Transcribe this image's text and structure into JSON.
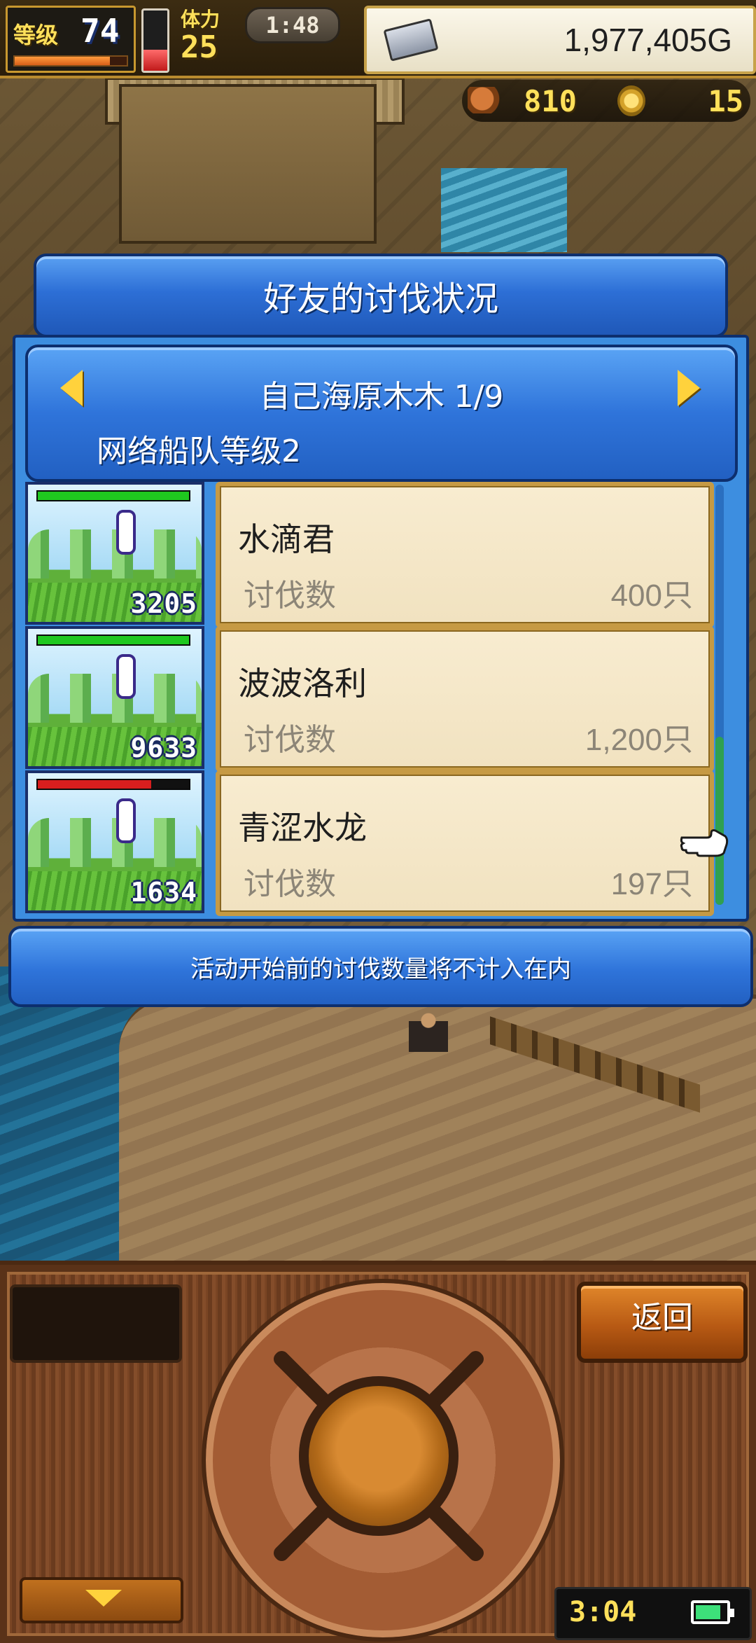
{
  "hud": {
    "level_label": "等级",
    "level_value": "74",
    "level_progress": 0.85,
    "stamina_level": 0.35,
    "strength_label": "体力",
    "strength_value": "25",
    "clock": "1:48",
    "gold": "1,977,405G",
    "food": "810",
    "coins": "15"
  },
  "dialog": {
    "title": "好友的讨伐状况",
    "friend_name": "自己海原木木 1/9",
    "fleet_level": "网络船队等级2",
    "notice": "活动开始前的讨伐数量将不计入在内",
    "kill_label": "讨伐数",
    "entries": [
      {
        "monster_id": "3205",
        "name": "水滴君",
        "kills": "400只",
        "hp_fraction": 1.0,
        "hp_color": "#1fc81f"
      },
      {
        "monster_id": "9633",
        "name": "波波洛利",
        "kills": "1,200只",
        "hp_fraction": 1.0,
        "hp_color": "#1fc81f"
      },
      {
        "monster_id": "1634",
        "name": "青涩水龙",
        "kills": "197只",
        "hp_fraction": 0.75,
        "hp_color": "#d81e1e"
      }
    ]
  },
  "controller": {
    "back_label": "返回",
    "system_time": "3:04",
    "battery_level": 0.85
  },
  "icons": {
    "left_arrow": "left-arrow-icon",
    "right_arrow": "right-arrow-icon",
    "pointer": "pointing-hand-icon",
    "gold": "silver-bar-icon",
    "food": "meat-icon",
    "coin": "coin-icon"
  }
}
